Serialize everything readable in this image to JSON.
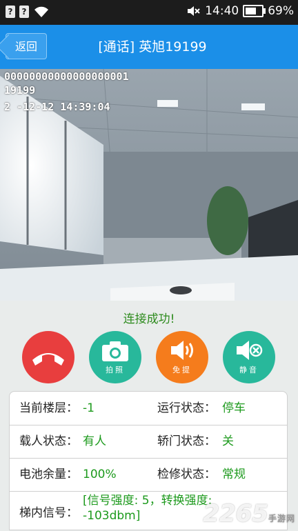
{
  "status_bar": {
    "sim1": "?",
    "sim2": "?",
    "time": "14:40",
    "battery": "69%",
    "battery_level": 0.69
  },
  "header": {
    "back_label": "返回",
    "title": "[通话] 英旭19199"
  },
  "video": {
    "osd_line1": "00000000000000000001",
    "osd_line2": "19199",
    "osd_line3": "2  -12-12 14:39:04"
  },
  "call": {
    "status": "连接成功!"
  },
  "controls": {
    "photo_label": "拍照",
    "speaker_label": "免提",
    "mute_label": "静音",
    "colors": {
      "hangup": "#e83e3e",
      "photo": "#28b89b",
      "speaker": "#f57c1c",
      "mute": "#28b89b"
    }
  },
  "info": {
    "floor_label": "当前楼层：",
    "floor_value": "-1",
    "run_label": "运行状态：",
    "run_value": "停车",
    "load_label": "载人状态：",
    "load_value": "有人",
    "door_label": "轿门状态：",
    "door_value": "关",
    "battery_label": "电池余量：",
    "battery_value": "100%",
    "maint_label": "检修状态：",
    "maint_value": "常规",
    "signal_label": "梯内信号：",
    "signal_value": "[信号强度: 5，转换强度: -103dbm]"
  },
  "watermark": {
    "brand": "2265",
    "sub": "手游网"
  }
}
